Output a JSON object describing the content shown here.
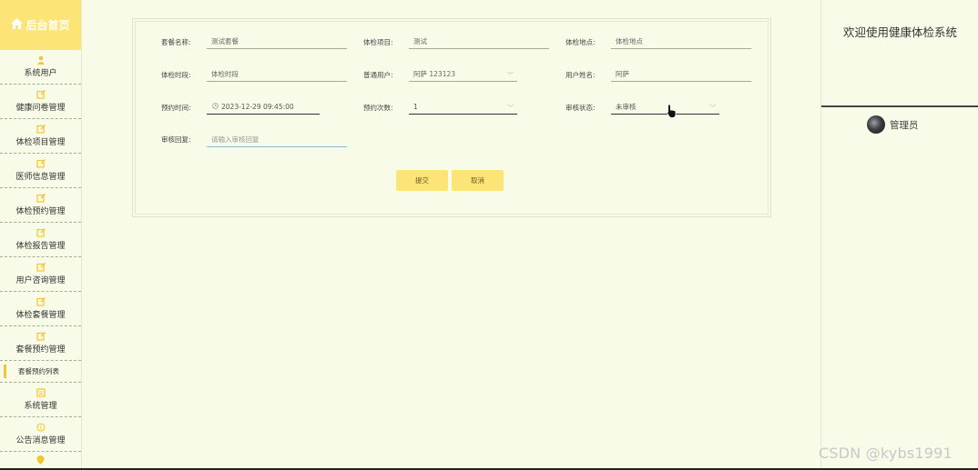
{
  "sidebar": {
    "home_label": "后台首页",
    "items": [
      {
        "label": "系统用户",
        "icon": "user-icon"
      },
      {
        "label": "健康问卷管理",
        "icon": "edit-icon"
      },
      {
        "label": "体检项目管理",
        "icon": "edit-icon"
      },
      {
        "label": "医师信息管理",
        "icon": "edit-icon"
      },
      {
        "label": "体检预约管理",
        "icon": "edit-icon"
      },
      {
        "label": "体检报告管理",
        "icon": "edit-icon"
      },
      {
        "label": "用户咨询管理",
        "icon": "edit-icon"
      },
      {
        "label": "体检套餐管理",
        "icon": "edit-icon"
      },
      {
        "label": "套餐预约管理",
        "icon": "edit-icon"
      }
    ],
    "active_sub": "套餐预约列表",
    "items_bottom": [
      {
        "label": "系统管理",
        "icon": "list-icon"
      },
      {
        "label": "公告消息管理",
        "icon": "info-icon"
      }
    ]
  },
  "form": {
    "package_name_label": "套餐名称:",
    "package_name_value": "测试套餐",
    "exam_item_label": "体检项目:",
    "exam_item_value": "测试",
    "location_label": "体检地点:",
    "location_value": "体检地点",
    "time_slot_label": "体检时段:",
    "time_slot_value": "体检时段",
    "user_label": "普通用户:",
    "user_value": "阿萨 123123",
    "user_name_label": "用户姓名:",
    "user_name_value": "阿萨",
    "appt_time_label": "预约时间:",
    "appt_time_value": "2023-12-29 09:45:00",
    "appt_count_label": "预约次数:",
    "appt_count_value": "1",
    "review_status_label": "审核状态:",
    "review_status_value": "未审核",
    "review_reply_label": "审核回复:",
    "review_reply_placeholder": "请输入审核回复",
    "submit_label": "提交",
    "cancel_label": "取消"
  },
  "header": {
    "welcome": "欢迎使用健康体检系统",
    "user_role": "管理员"
  },
  "watermark": "CSDN @kybs1991",
  "colors": {
    "background": "#f8fbe8",
    "accent": "#fde476"
  }
}
